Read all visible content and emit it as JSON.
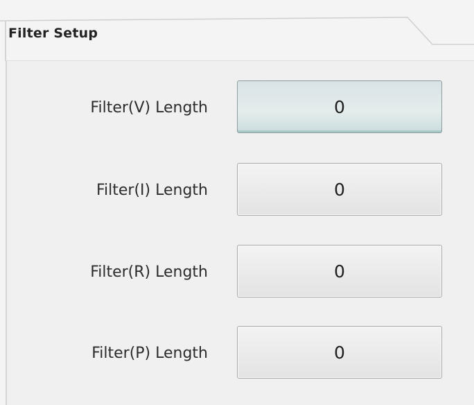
{
  "tab": {
    "title": "Filter Setup"
  },
  "rows": [
    {
      "label": "Filter(V) Length",
      "value": "0",
      "focused": true
    },
    {
      "label": "Filter(I) Length",
      "value": "0",
      "focused": false
    },
    {
      "label": "Filter(R) Length",
      "value": "0",
      "focused": false
    },
    {
      "label": "Filter(P) Length",
      "value": "0",
      "focused": false
    }
  ],
  "colors": {
    "background": "#f4f4f4",
    "button_border": "#a9a9a9",
    "focused_button": "#d9e3e6"
  }
}
